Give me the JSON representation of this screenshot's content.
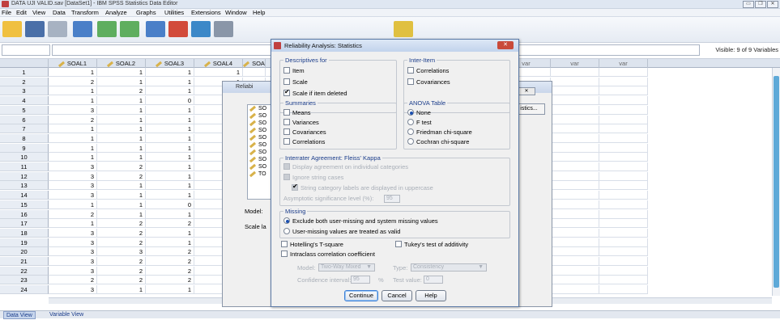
{
  "window": {
    "title": "DATA UJI VALID.sav [DataSet1] - IBM SPSS Statistics Data Editor"
  },
  "menu": [
    "File",
    "Edit",
    "View",
    "Data",
    "Transform",
    "Analyze",
    "Graphs",
    "Utilities",
    "Extensions",
    "Window",
    "Help"
  ],
  "visible_label": "Visible: 9 of 9 Variables",
  "columns": [
    "SOAL1",
    "SOAL2",
    "SOAL3",
    "SOAL4",
    "SOA",
    "var",
    "var",
    "var",
    "var",
    "var",
    "var",
    "var",
    "var"
  ],
  "rows": [
    {
      "n": "1",
      "v": [
        "1",
        "1",
        "1",
        "1"
      ]
    },
    {
      "n": "2",
      "v": [
        "2",
        "1",
        "1",
        "1"
      ]
    },
    {
      "n": "3",
      "v": [
        "1",
        "2",
        "1",
        "1"
      ]
    },
    {
      "n": "4",
      "v": [
        "1",
        "1",
        "0",
        "1"
      ]
    },
    {
      "n": "5",
      "v": [
        "3",
        "1",
        "1",
        "1"
      ]
    },
    {
      "n": "6",
      "v": [
        "2",
        "1",
        "1",
        "1"
      ]
    },
    {
      "n": "7",
      "v": [
        "1",
        "1",
        "1",
        "1"
      ]
    },
    {
      "n": "8",
      "v": [
        "1",
        "1",
        "1",
        "1"
      ]
    },
    {
      "n": "9",
      "v": [
        "1",
        "1",
        "1",
        "1"
      ]
    },
    {
      "n": "10",
      "v": [
        "1",
        "1",
        "1",
        "1"
      ]
    },
    {
      "n": "11",
      "v": [
        "3",
        "2",
        "1",
        "1"
      ]
    },
    {
      "n": "12",
      "v": [
        "3",
        "2",
        "1",
        "1"
      ]
    },
    {
      "n": "13",
      "v": [
        "3",
        "1",
        "1",
        "1"
      ]
    },
    {
      "n": "14",
      "v": [
        "3",
        "1",
        "1",
        "1"
      ]
    },
    {
      "n": "15",
      "v": [
        "1",
        "1",
        "0",
        "1"
      ]
    },
    {
      "n": "16",
      "v": [
        "2",
        "1",
        "1",
        "1"
      ]
    },
    {
      "n": "17",
      "v": [
        "1",
        "2",
        "2",
        "1"
      ]
    },
    {
      "n": "18",
      "v": [
        "3",
        "2",
        "1",
        "1"
      ]
    },
    {
      "n": "19",
      "v": [
        "3",
        "2",
        "1",
        "1"
      ]
    },
    {
      "n": "20",
      "v": [
        "3",
        "3",
        "2",
        "1"
      ]
    },
    {
      "n": "21",
      "v": [
        "3",
        "2",
        "2",
        "2"
      ]
    },
    {
      "n": "22",
      "v": [
        "3",
        "2",
        "2",
        "1"
      ]
    },
    {
      "n": "23",
      "v": [
        "2",
        "2",
        "2",
        "1"
      ]
    },
    {
      "n": "24",
      "v": [
        "3",
        "1",
        "1",
        "1"
      ]
    }
  ],
  "tabs": [
    "Data View",
    "Variable View"
  ],
  "bg_dialog": {
    "title": "Reliabi",
    "items": [
      "SO",
      "SO",
      "SO",
      "SO",
      "SO",
      "SO",
      "SO",
      "SO",
      "SO",
      "TO"
    ],
    "model_label": "Model:",
    "scale_label": "Scale la",
    "stats_button": "istics..."
  },
  "dialog": {
    "title": "Reliability Analysis: Statistics",
    "descriptives": {
      "label": "Descriptives for",
      "item": "Item",
      "scale": "Scale",
      "scale_deleted": "Scale if item deleted"
    },
    "interitem": {
      "label": "Inter-Item",
      "correlations": "Correlations",
      "covariances": "Covariances"
    },
    "summaries": {
      "label": "Summaries",
      "means": "Means",
      "variances": "Variances",
      "covariances": "Covariances",
      "correlations": "Correlations"
    },
    "anova": {
      "label": "ANOVA Table",
      "none": "None",
      "ftest": "F test",
      "friedman": "Friedman chi-square",
      "cochran": "Cochran chi-square"
    },
    "interrater": {
      "label": "Interrater Agreement: Fleiss' Kappa",
      "display": "Display agreement on individual categories",
      "ignore": "Ignore string cases",
      "uppercase": "String category labels are displayed in uppercase",
      "asym_label": "Asymptotic significance level (%):",
      "asym_value": "95"
    },
    "missing": {
      "label": "Missing",
      "exclude": "Exclude both user-missing and system missing values",
      "valid": "User-missing values are treated as valid"
    },
    "hotelling": "Hotelling's T-square",
    "tukey": "Tukey's test of additivity",
    "icc": "Intraclass correlation coefficient",
    "model_label": "Model:",
    "model_value": "Two-Way Mixed",
    "type_label": "Type:",
    "type_value": "Consistency",
    "ci_label": "Confidence interval:",
    "ci_value": "95",
    "ci_unit": "%",
    "test_label": "Test value:",
    "test_value": "0",
    "continue": "Continue",
    "cancel": "Cancel",
    "help": "Help"
  }
}
